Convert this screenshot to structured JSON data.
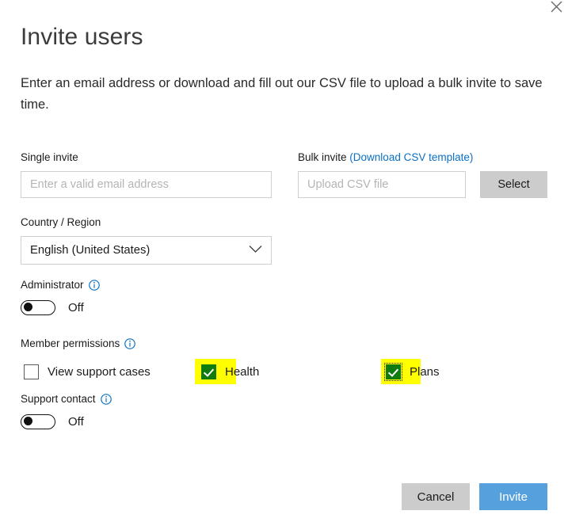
{
  "dialog": {
    "title": "Invite users",
    "description": "Enter an email address or download and fill out our CSV file to upload a bulk invite to save time.",
    "close_icon": "close-icon"
  },
  "single_invite": {
    "label": "Single invite",
    "placeholder": "Enter a valid email address",
    "value": ""
  },
  "bulk_invite": {
    "label": "Bulk invite",
    "link_label": "(Download CSV template)",
    "placeholder": "Upload CSV file",
    "value": "",
    "select_label": "Select"
  },
  "country": {
    "label": "Country / Region",
    "selected": "English (United States)",
    "chevron_icon": "chevron-down-icon"
  },
  "administrator": {
    "label": "Administrator",
    "info_icon": "info-icon",
    "state": "Off",
    "checked": false
  },
  "member_permissions": {
    "label": "Member permissions",
    "info_icon": "info-icon",
    "items": [
      {
        "label": "View support cases",
        "checked": false,
        "highlighted": false,
        "focused": false
      },
      {
        "label": "Health",
        "checked": true,
        "highlighted": true,
        "focused": false
      },
      {
        "label": "Plans",
        "checked": true,
        "highlighted": true,
        "focused": true
      }
    ]
  },
  "support_contact": {
    "label": "Support contact",
    "info_icon": "info-icon",
    "state": "Off",
    "checked": false
  },
  "footer": {
    "cancel_label": "Cancel",
    "invite_label": "Invite"
  },
  "colors": {
    "link": "#0a70c4",
    "primary_button": "#56a0dd",
    "secondary_button": "#cccccc",
    "checkbox_checked": "#107c10",
    "highlight": "#ffff00",
    "info_icon": "#0a70c4"
  }
}
